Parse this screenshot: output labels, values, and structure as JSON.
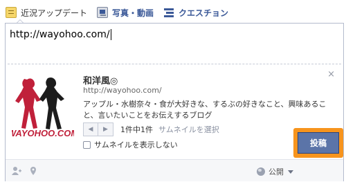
{
  "tabs": [
    {
      "label": "近況アップデート",
      "icon": "status-icon",
      "active": true
    },
    {
      "label": "写真・動画",
      "icon": "photo-icon",
      "active": false
    },
    {
      "label": "クエスチョン",
      "icon": "question-icon",
      "active": false
    }
  ],
  "composer": {
    "text": "http://wayohoo.com/"
  },
  "preview": {
    "title": "和洋風◎",
    "url": "http://wayohoo.com/",
    "description": "アップル・水樹奈々・食が大好きな、するぶの好きなこと、興味あること、言いたいことをお伝えするブログ",
    "thumbnail_text": "WAYOHOO.COM",
    "pager_prev": "◀",
    "pager_next": "▶",
    "thumbnail_count": "1件中1件",
    "select_thumbnail": "サムネイルを選択",
    "no_thumbnail_label": "サムネイルを表示しない",
    "close": "×"
  },
  "footer": {
    "privacy_label": "公開",
    "post_label": "投稿"
  },
  "colors": {
    "link_blue": "#3b5998",
    "post_button": "#5b74a8",
    "highlight": "#f7941d",
    "logo_red": "#c0203a"
  }
}
